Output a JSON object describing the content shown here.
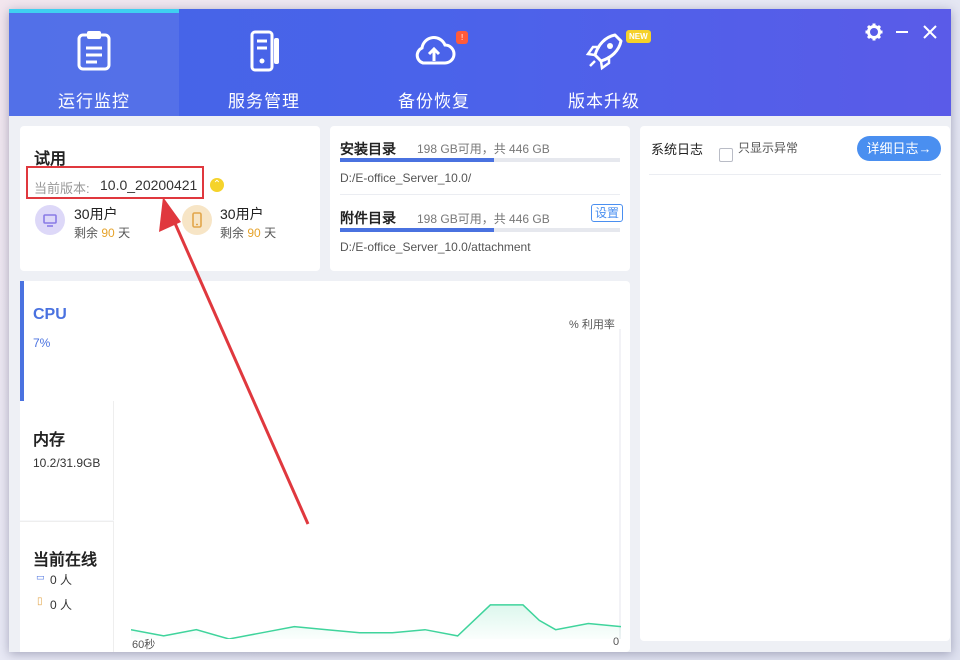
{
  "nav": {
    "tabs": [
      {
        "label": "运行监控",
        "icon": "clipboard-icon"
      },
      {
        "label": "服务管理",
        "icon": "server-icon"
      },
      {
        "label": "备份恢复",
        "icon": "cloud-upload-icon",
        "badge": "!"
      },
      {
        "label": "版本升级",
        "icon": "rocket-icon",
        "badge": "NEW"
      }
    ]
  },
  "license": {
    "title": "试用",
    "version_label": "当前版本:",
    "version_value": "10.0_20200421",
    "pc": {
      "users": "30用户",
      "remain_prefix": "剩余",
      "days": "90",
      "unit": "天"
    },
    "mobile": {
      "users": "30用户",
      "remain_prefix": "剩余",
      "days": "90",
      "unit": "天"
    }
  },
  "dirs": {
    "install": {
      "title": "安装目录",
      "space": "198 GB可用，共 446 GB",
      "path": "D:/E-office_Server_10.0/",
      "used_fraction": 0.55
    },
    "attach": {
      "title": "附件目录",
      "space": "198 GB可用，共 446 GB",
      "path": "D:/E-office_Server_10.0/attachment",
      "settings": "设置",
      "used_fraction": 0.55
    }
  },
  "monitor": {
    "cpu": {
      "title": "CPU",
      "value": "7%"
    },
    "memory": {
      "title": "内存",
      "value": "10.2/31.9GB"
    },
    "online": {
      "title": "当前在线",
      "pc": "0 人",
      "mobile": "0 人"
    },
    "chart_unit": "% 利用率",
    "x_left": "60秒",
    "x_right": "0"
  },
  "chart_data": {
    "type": "area",
    "x": [
      60,
      56,
      52,
      48,
      44,
      40,
      36,
      32,
      28,
      24,
      20,
      16,
      12,
      10,
      8,
      4,
      0
    ],
    "values": [
      3,
      1,
      3,
      0,
      2,
      4,
      3,
      2,
      2,
      3,
      1,
      11,
      11,
      6,
      3,
      5,
      4
    ],
    "ylabel": "% 利用率",
    "ylim": [
      0,
      100
    ],
    "x_tick_labels": [
      "60秒",
      "0"
    ]
  },
  "log": {
    "title": "系统日志",
    "only_errors": "只显示异常",
    "detail_button": "详细日志→"
  },
  "colors": {
    "accent": "#4a72e0",
    "header": "#4a63ea",
    "highlight_box": "#e0383e",
    "days": "#e6a32b",
    "chart_line": "#3fd49c"
  }
}
